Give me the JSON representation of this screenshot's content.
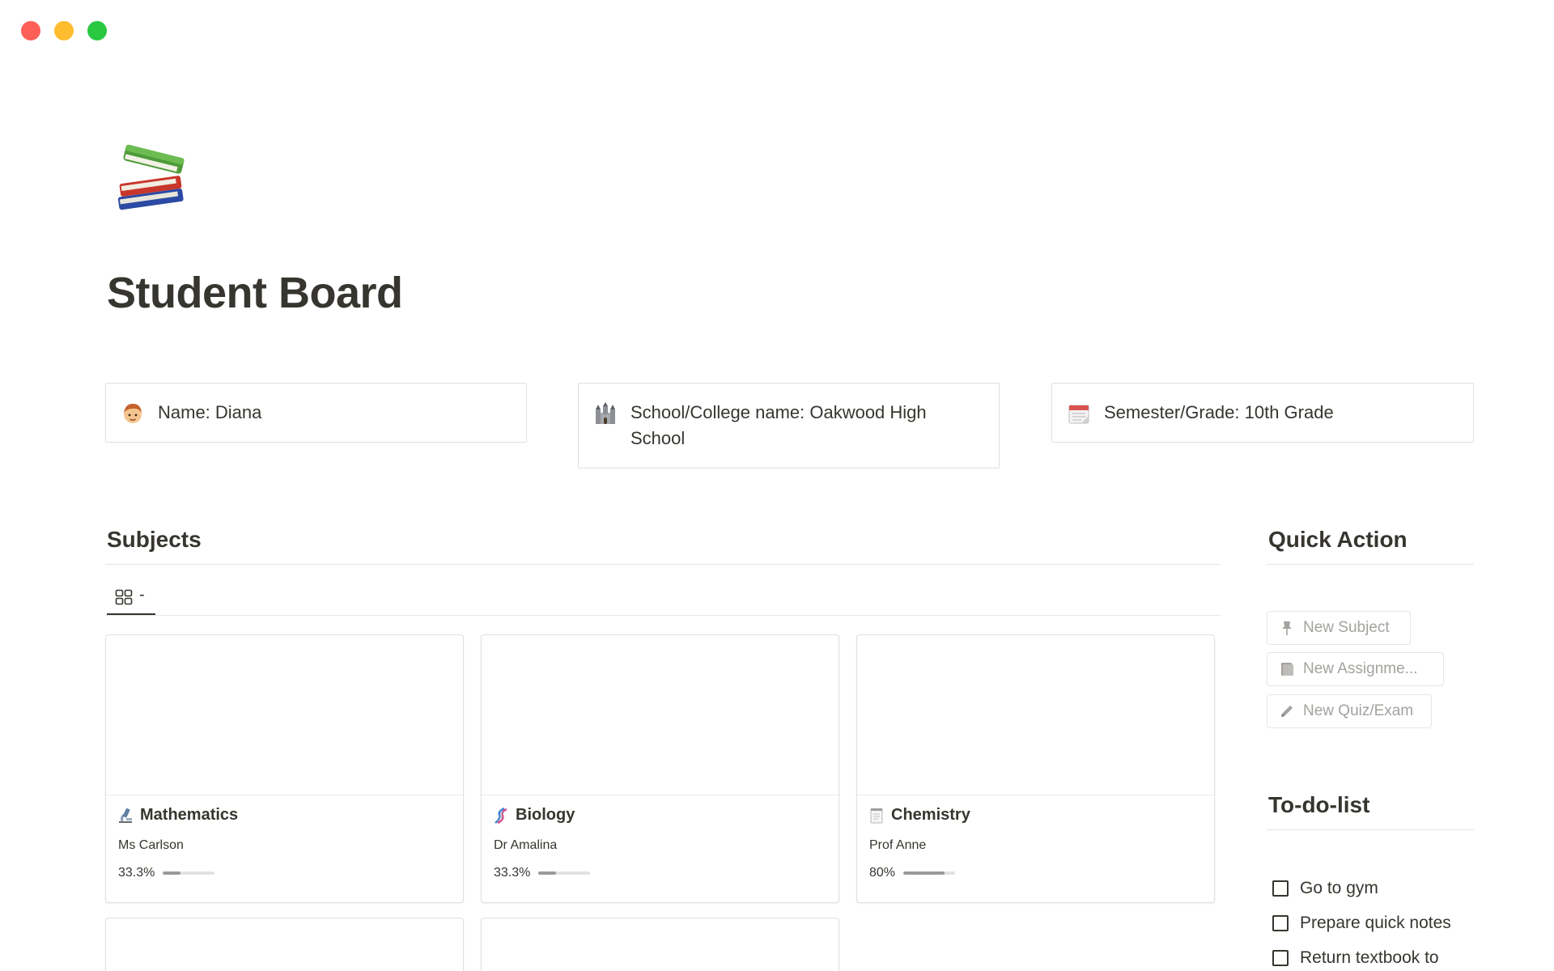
{
  "page": {
    "title": "Student Board",
    "icon": "books-icon"
  },
  "info": [
    {
      "icon": "student-icon",
      "label": "Name: Diana"
    },
    {
      "icon": "castle-icon",
      "label": "School/College name: Oakwood High School"
    },
    {
      "icon": "calendar-icon",
      "label": "Semester/Grade: 10th Grade"
    }
  ],
  "subjects": {
    "heading": "Subjects",
    "view_tab_label": "-",
    "view_tab_icon": "gallery-grid-icon",
    "cards": [
      {
        "icon": "microscope-icon",
        "title": "Mathematics",
        "teacher": "Ms Carlson",
        "progress_label": "33.3%",
        "progress": 0.333
      },
      {
        "icon": "dna-icon",
        "title": "Biology",
        "teacher": "Dr Amalina",
        "progress_label": "33.3%",
        "progress": 0.333
      },
      {
        "icon": "notepad-icon",
        "title": "Chemistry",
        "teacher": "Prof Anne",
        "progress_label": "80%",
        "progress": 0.8
      }
    ]
  },
  "quick_action": {
    "heading": "Quick Action",
    "buttons": [
      {
        "icon": "pin-icon",
        "label": "New Subject"
      },
      {
        "icon": "notebook-icon",
        "label": "New Assignme..."
      },
      {
        "icon": "pencil-icon",
        "label": "New Quiz/Exam"
      }
    ]
  },
  "todo": {
    "heading": "To-do-list",
    "items": [
      {
        "label": "Go to gym",
        "checked": false
      },
      {
        "label": "Prepare quick notes",
        "checked": false
      },
      {
        "label": "Return textbook to",
        "checked": false
      }
    ]
  },
  "colors": {
    "text": "#37352f",
    "muted": "#a3a29e",
    "border": "#e1e0dd",
    "progress_fill": "#9b9a97",
    "progress_track": "#e3e2e0"
  }
}
